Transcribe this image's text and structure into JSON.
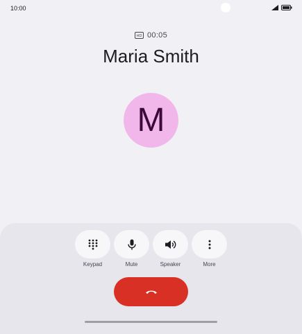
{
  "status_bar": {
    "time": "10:00",
    "icons": [
      "signal-icon",
      "battery-icon"
    ]
  },
  "call": {
    "quality_icon": "hd-icon",
    "duration": "00:05",
    "contact_name": "Maria Smith",
    "avatar_letter": "M",
    "avatar_color": "#f2b7ea"
  },
  "controls": [
    {
      "label": "Keypad",
      "icon": "dialpad-icon"
    },
    {
      "label": "Mute",
      "icon": "microphone-icon"
    },
    {
      "label": "Speaker",
      "icon": "speaker-icon"
    },
    {
      "label": "More",
      "icon": "more-vertical-icon"
    }
  ],
  "end_call": {
    "icon": "end-call-icon",
    "color": "#d93025"
  }
}
